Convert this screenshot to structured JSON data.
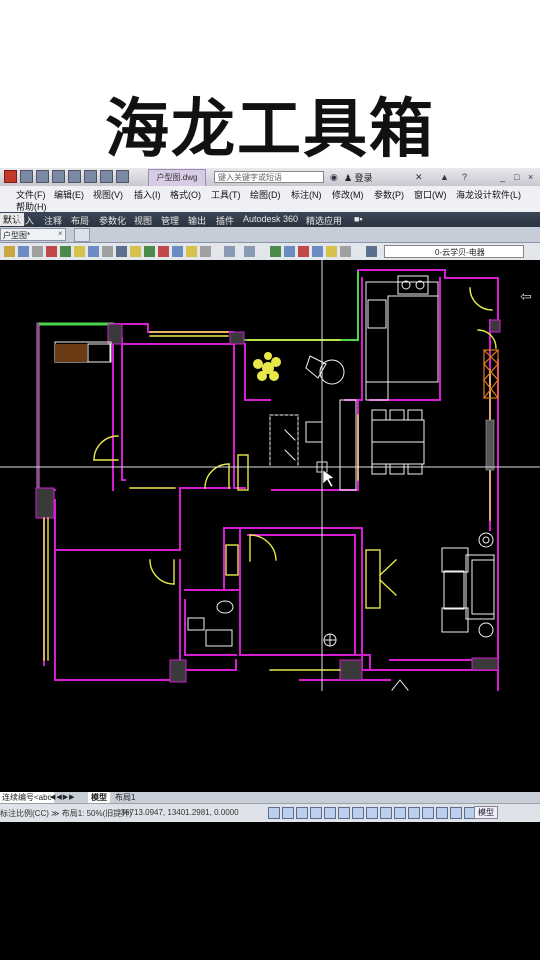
{
  "banner": {
    "title": "海龙工具箱"
  },
  "titlebar": {
    "file_name": "户型图.dwg",
    "search_placeholder": "键入关键字或短语",
    "login_label": "登录",
    "help_label": "?"
  },
  "menu": {
    "items": [
      "文件(F)",
      "编辑(E)",
      "视图(V)",
      "插入(I)",
      "格式(O)",
      "工具(T)",
      "绘图(D)",
      "标注(N)",
      "修改(M)",
      "参数(P)",
      "窗口(W)",
      "海龙设计软件(L)",
      "帮助(H)"
    ]
  },
  "ribbon": {
    "tabs": [
      "默认",
      "插入",
      "注释",
      "布局",
      "参数化",
      "视图",
      "管理",
      "输出",
      "插件",
      "Autodesk 360",
      "精选应用",
      "■▪"
    ],
    "active_index": 0
  },
  "document_tab": {
    "label": "户型图*",
    "close": "×"
  },
  "properties": {
    "layer_name": "0-云学贝-电器"
  },
  "layout_tabs": {
    "left_label": "连续编号<abc",
    "nav": "◀◀▶▶",
    "tabs": [
      "模型",
      "布局1"
    ],
    "active_index": 0
  },
  "statusbar": {
    "left_text": "标注比例(CC) ≫ 布局1: 50%(旧提升)",
    "coordinates": "-36713.0947, 13401.2981, 0.0000",
    "model_label": "模型"
  },
  "colors": {
    "wall": "#d51dd1",
    "fixture": "#e8e84a",
    "furniture": "#f2f2f2",
    "green": "#4cd64c",
    "crosshair": "#e0e0e0",
    "orange": "#e07a1a"
  }
}
